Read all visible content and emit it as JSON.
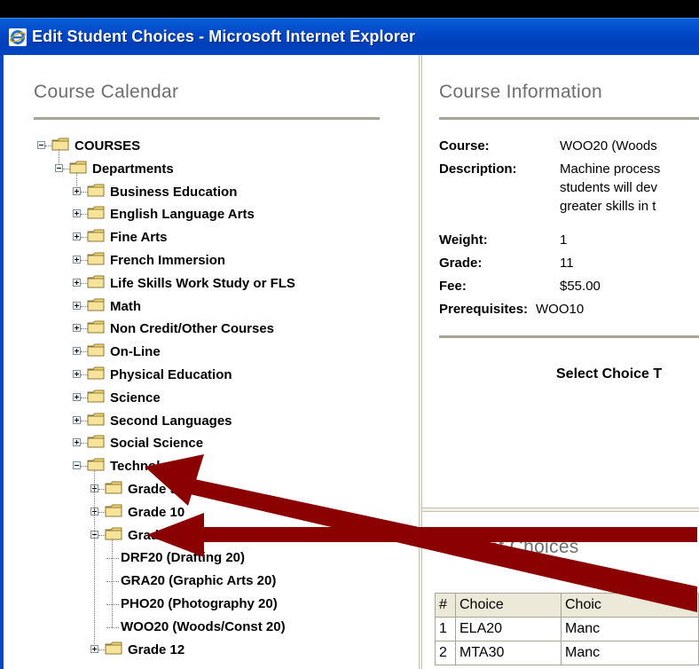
{
  "window": {
    "title": "Edit Student Choices - Microsoft Internet Explorer"
  },
  "calendar": {
    "title": "Course Calendar",
    "root": "COURSES",
    "departments_label": "Departments",
    "departments": [
      "Business Education",
      "English Language Arts",
      "Fine Arts",
      "French Immersion",
      "Life Skills Work Study or FLS",
      "Math",
      "Non Credit/Other Courses",
      "On-Line",
      "Physical Education",
      "Science",
      "Second Languages",
      "Social Science",
      "Technology"
    ],
    "tech_children": [
      "Grade 9",
      "Grade 10",
      "Grade 11",
      "Grade 12"
    ],
    "grade11_courses": [
      "DRF20 (Drafting 20)",
      "GRA20 (Graphic Arts 20)",
      "PHO20 (Photography 20)",
      "WOO20 (Woods/Const 20)"
    ]
  },
  "info": {
    "title": "Course Information",
    "course_label": "Course:",
    "course_value": "WOO20 (Woods",
    "description_label": "Description:",
    "description_lines": [
      "Machine process",
      "students will dev",
      "greater skills in t"
    ],
    "weight_label": "Weight:",
    "weight_value": "1",
    "grade_label": "Grade:",
    "grade_value": "11",
    "fee_label": "Fee:",
    "fee_value": "$55.00",
    "prereq_label": "Prerequisites:",
    "prereq_value": "WOO10",
    "select_choice": "Select Choice T"
  },
  "choices": {
    "title": "Student Choices",
    "headers": [
      "#",
      "Choice",
      "Choic"
    ],
    "rows": [
      [
        "1",
        "ELA20",
        "Manc"
      ],
      [
        "2",
        "MTA30",
        "Manc"
      ]
    ]
  },
  "colors": {
    "titlebar": "#0048c8",
    "arrow": "#8b0000",
    "folder": "#f5d76e"
  }
}
